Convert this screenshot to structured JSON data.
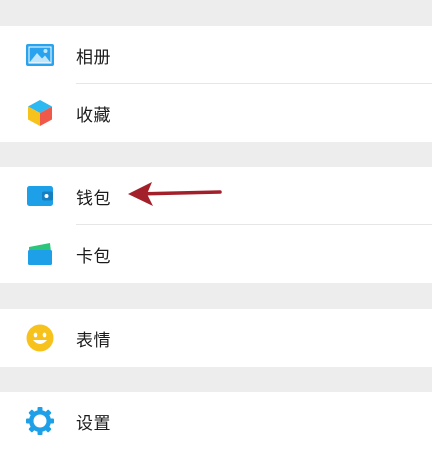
{
  "menu": {
    "album": {
      "label": "相册",
      "icon": "album-icon"
    },
    "favorites": {
      "label": "收藏",
      "icon": "cube-icon"
    },
    "wallet": {
      "label": "钱包",
      "icon": "wallet-icon"
    },
    "cards": {
      "label": "卡包",
      "icon": "card-icon"
    },
    "stickers": {
      "label": "表情",
      "icon": "smiley-icon"
    },
    "settings": {
      "label": "设置",
      "icon": "gear-icon"
    }
  },
  "annotation": {
    "type": "arrow",
    "color": "#a3202b",
    "points_to": "wallet"
  },
  "colors": {
    "background": "#ededed",
    "row": "#ffffff",
    "accent_blue": "#1ea0e8",
    "accent_green": "#2cc57a",
    "accent_yellow": "#f6c21b"
  }
}
